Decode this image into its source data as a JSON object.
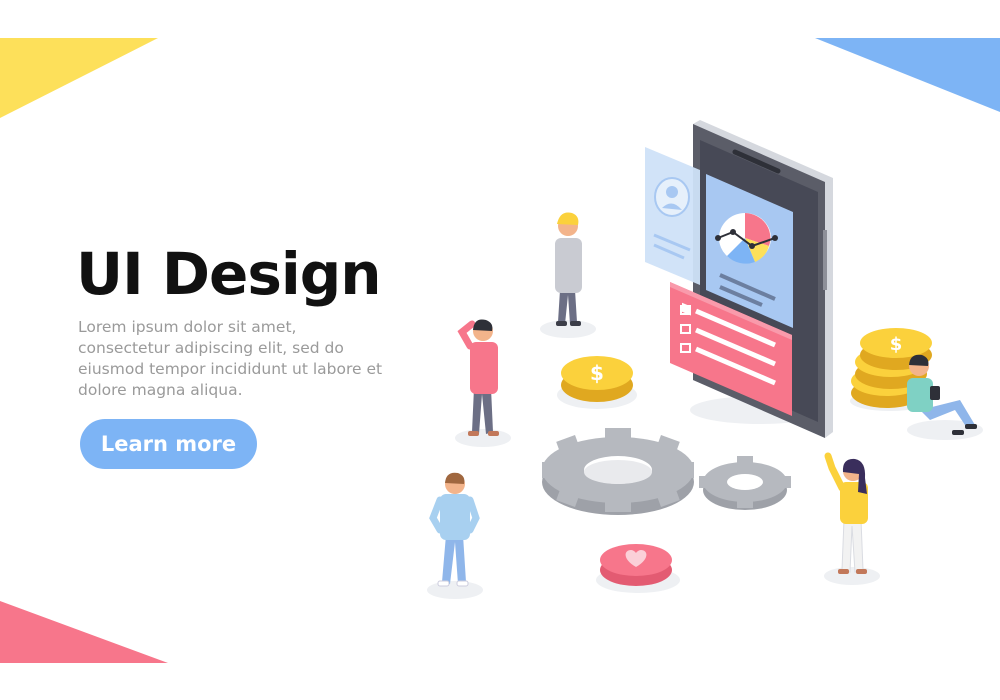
{
  "hero": {
    "title": "UI Design",
    "body": "Lorem ipsum dolor sit amet, consectetur adipiscing elit, sed do eiusmod tempor incididunt ut labore et dolore magna aliqua.",
    "cta_label": "Learn more"
  },
  "colors": {
    "accent_blue": "#7db4f5",
    "corner_yellow": "#fde05a",
    "corner_blue": "#7db4f5",
    "corner_pink": "#f7768b",
    "panel_pink": "#f7768b",
    "coin_gold": "#fbd13c",
    "gear_gray": "#b6b9bf"
  },
  "icons": [
    "phone-icon",
    "user-profile-card-icon",
    "pie-chart-icon",
    "checklist-panel-icon",
    "dollar-coin-icon",
    "coin-stack-icon",
    "gear-large-icon",
    "gear-small-icon",
    "heart-button-icon"
  ]
}
